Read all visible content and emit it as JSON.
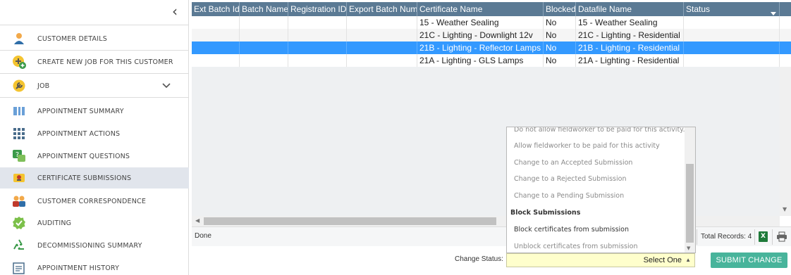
{
  "sidebar": {
    "collapse_glyph": "‹",
    "items": [
      {
        "label": "CUSTOMER DETAILS",
        "icon": "person-icon"
      },
      {
        "label": "CREATE NEW JOB FOR THIS CUSTOMER",
        "icon": "add-job-icon"
      },
      {
        "label": "JOB",
        "icon": "wrench-icon"
      },
      {
        "label": "APPOINTMENT SUMMARY",
        "icon": "columns-icon"
      },
      {
        "label": "APPOINTMENT ACTIONS",
        "icon": "grid-icon"
      },
      {
        "label": "APPOINTMENT QUESTIONS",
        "icon": "question-icon"
      },
      {
        "label": "CERTIFICATE SUBMISSIONS",
        "icon": "certificate-icon"
      },
      {
        "label": "CUSTOMER CORRESPONDENCE",
        "icon": "people-icon"
      },
      {
        "label": "AUDITING",
        "icon": "check-icon"
      },
      {
        "label": "DECOMMISSIONING SUMMARY",
        "icon": "recycle-icon"
      },
      {
        "label": "APPOINTMENT HISTORY",
        "icon": "history-icon"
      }
    ],
    "active_label": "CERTIFICATE SUBMISSIONS"
  },
  "grid": {
    "columns": [
      "Ext Batch Id",
      "Batch Name",
      "Registration ID",
      "Export Batch Num",
      "Certificate Name",
      "Blocked",
      "Datafile Name",
      "Status"
    ],
    "rows": [
      [
        "",
        "",
        "",
        "",
        "15 - Weather Sealing",
        "No",
        "15 - Weather Sealing",
        ""
      ],
      [
        "",
        "",
        "",
        "",
        "21C - Lighting - Downlight 12v",
        "No",
        "21C - Lighting - Residential",
        ""
      ],
      [
        "",
        "",
        "",
        "",
        "21B - Lighting - Reflector Lamps",
        "No",
        "21B - Lighting - Residential",
        ""
      ],
      [
        "",
        "",
        "",
        "",
        "21A - Lighting - GLS Lamps",
        "No",
        "21A - Lighting - Residential",
        ""
      ]
    ],
    "selected_row": 3
  },
  "footer": {
    "status_text": "Done",
    "total_records": "Total Records: 4",
    "excel_glyph": "X"
  },
  "change": {
    "label": "Change Status:",
    "select_value": "Select One",
    "submit_label": "SUBMIT CHANGE"
  },
  "dropdown": {
    "items": [
      {
        "label": "Do not allow fieldworker to be paid for this activity.",
        "kind": "disabled"
      },
      {
        "label": "Allow fieldworker to be paid for this activity",
        "kind": "disabled"
      },
      {
        "label": "Change to an Accepted Submission",
        "kind": "disabled"
      },
      {
        "label": "Change to a Rejected Submission",
        "kind": "disabled"
      },
      {
        "label": "Change to a Pending Submission",
        "kind": "disabled"
      },
      {
        "label": "Block Submissions",
        "kind": "group"
      },
      {
        "label": "Block certificates from submission",
        "kind": "enabled"
      },
      {
        "label": "Unblock certificates from submission",
        "kind": "disabled"
      }
    ]
  },
  "colors": {
    "header_bg": "#5b7a94",
    "selected_row": "#3399ff",
    "submit_bg": "#48b49b",
    "select_bg": "#ffffcc",
    "active_sidebar": "#e1e5ec"
  }
}
